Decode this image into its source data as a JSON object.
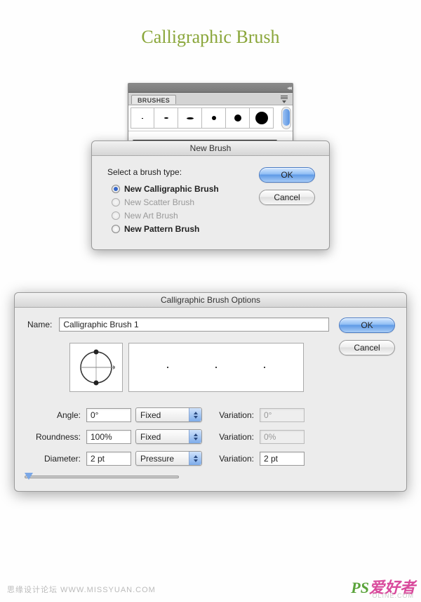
{
  "page_title": "Calligraphic Brush",
  "brushes_panel": {
    "tab_label": "BRUSHES"
  },
  "new_brush": {
    "title": "New Brush",
    "prompt": "Select a brush type:",
    "options": [
      {
        "label": "New Calligraphic Brush",
        "checked": true,
        "disabled": false,
        "bold": true
      },
      {
        "label": "New Scatter Brush",
        "checked": false,
        "disabled": true,
        "bold": false
      },
      {
        "label": "New Art Brush",
        "checked": false,
        "disabled": true,
        "bold": false
      },
      {
        "label": "New Pattern Brush",
        "checked": false,
        "disabled": false,
        "bold": true
      }
    ],
    "ok": "OK",
    "cancel": "Cancel"
  },
  "cbo": {
    "title": "Calligraphic Brush Options",
    "name_label": "Name:",
    "name_value": "Calligraphic Brush 1",
    "ok": "OK",
    "cancel": "Cancel",
    "rows": {
      "angle": {
        "label": "Angle:",
        "value": "0°",
        "mode": "Fixed",
        "var_label": "Variation:",
        "var_value": "0°",
        "var_disabled": true
      },
      "roundness": {
        "label": "Roundness:",
        "value": "100%",
        "mode": "Fixed",
        "var_label": "Variation:",
        "var_value": "0%",
        "var_disabled": true
      },
      "diameter": {
        "label": "Diameter:",
        "value": "2 pt",
        "mode": "Pressure",
        "var_label": "Variation:",
        "var_value": "2 pt",
        "var_disabled": false
      }
    }
  },
  "watermark": {
    "left": "思缘设计论坛  WWW.MISSYUAN.COM",
    "right_g": "PS",
    "right_r": "爱好者",
    "sub": "OLINE.COM"
  }
}
